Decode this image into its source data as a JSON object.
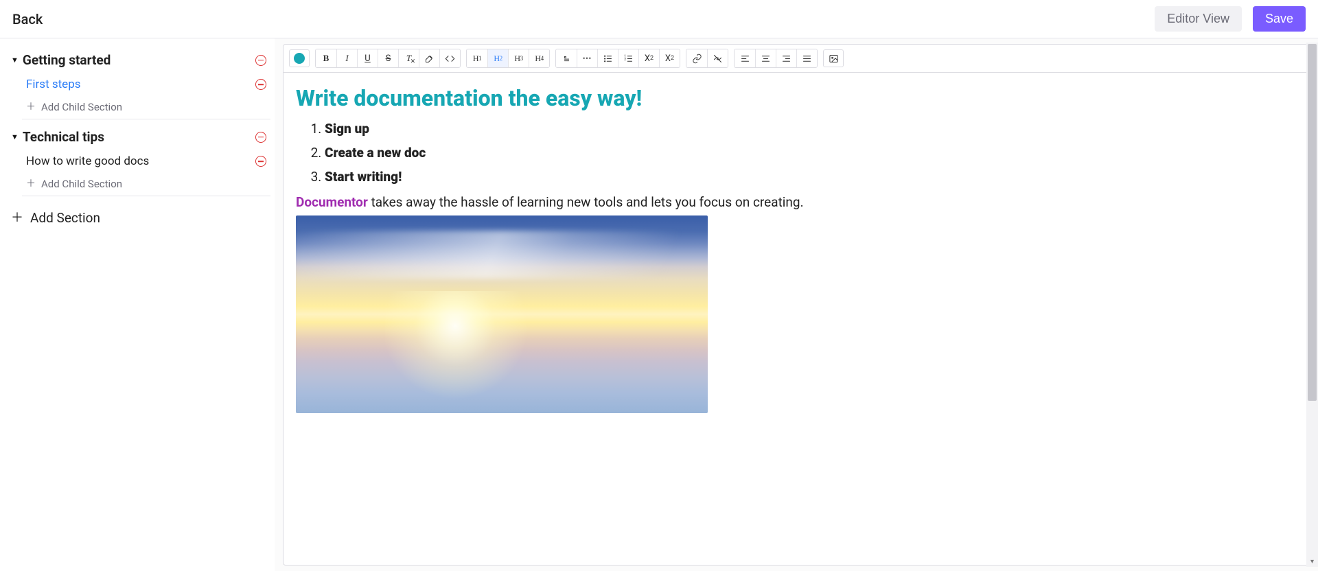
{
  "top": {
    "back": "Back",
    "editor_view": "Editor View",
    "save": "Save"
  },
  "sidebar": {
    "sections": [
      {
        "title": "Getting started",
        "children": [
          {
            "label": "First steps",
            "active": true
          }
        ],
        "add_child": "Add Child Section"
      },
      {
        "title": "Technical tips",
        "children": [
          {
            "label": "How to write good docs",
            "active": false
          }
        ],
        "add_child": "Add Child Section"
      }
    ],
    "add_section": "Add Section"
  },
  "toolbar": {
    "color": "#17a7b3",
    "h1": "H1",
    "h2": "H2",
    "h3": "H3",
    "h4": "H4",
    "x2_sub": "X",
    "x2_sup": "X"
  },
  "doc": {
    "title": "Write documentation the easy way!",
    "steps": [
      "Sign up",
      "Create a new doc",
      "Start writing!"
    ],
    "brand": "Documentor",
    "tagline_rest": " takes away the hassle of learning new tools and lets you focus on creating."
  }
}
